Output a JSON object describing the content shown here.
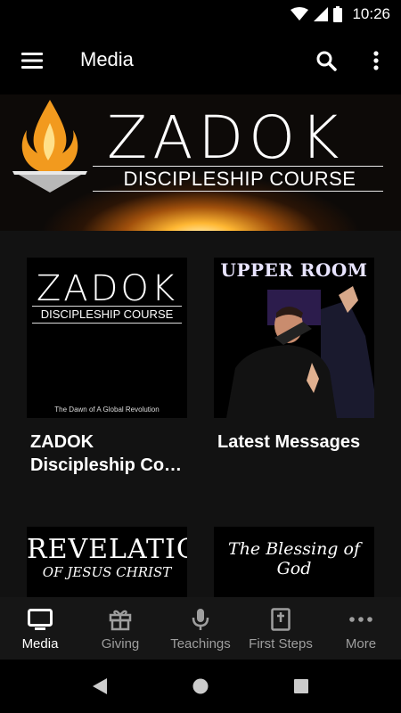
{
  "status_bar": {
    "time": "10:26"
  },
  "app_bar": {
    "title": "Media"
  },
  "hero": {
    "title": "ZADOK",
    "subtitle": "DISCIPLESHIP COURSE"
  },
  "cards": [
    {
      "title": "ZADOK Discipleship Course",
      "display_title": "ZADOK Discipleship Co…",
      "thumb": {
        "title": "ZADOK",
        "subtitle": "DISCIPLESHIP COURSE",
        "tagline": "The Dawn of A Global Revolution"
      }
    },
    {
      "title": "Latest Messages",
      "thumb": {
        "banner": "UPPER ROOM"
      }
    },
    {
      "title": "",
      "thumb": {
        "line1": "REVELATION",
        "line2": "OF JESUS CHRIST"
      }
    },
    {
      "title": "",
      "thumb": {
        "line1": "The Blessing of God"
      }
    }
  ],
  "bottom_nav": [
    {
      "label": "Media",
      "icon": "tv-icon",
      "active": true
    },
    {
      "label": "Giving",
      "icon": "gift-icon",
      "active": false
    },
    {
      "label": "Teachings",
      "icon": "microphone-icon",
      "active": false
    },
    {
      "label": "First Steps",
      "icon": "bible-icon",
      "active": false
    },
    {
      "label": "More",
      "icon": "more-dots-icon",
      "active": false
    }
  ],
  "colors": {
    "background": "#121212",
    "bar": "#000000",
    "nav_background": "#161616",
    "nav_inactive": "#9e9e9e",
    "nav_active": "#ffffff"
  }
}
